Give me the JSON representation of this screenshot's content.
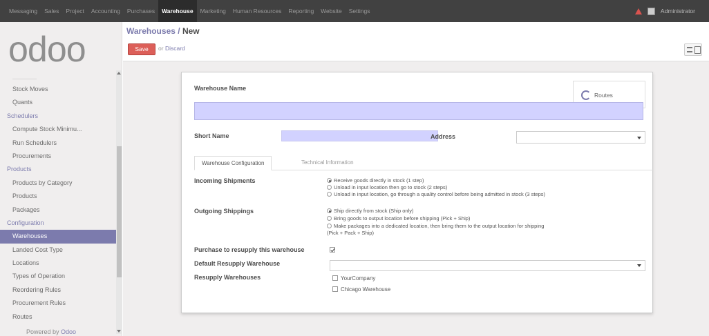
{
  "topbar": {
    "menu": [
      "Messaging",
      "Sales",
      "Project",
      "Accounting",
      "Purchases",
      "Warehouse",
      "Marketing",
      "Human Resources",
      "Reporting",
      "Website",
      "Settings"
    ],
    "active_menu": "Warehouse",
    "user": "Administrator"
  },
  "sidebar": {
    "logo": "odoo",
    "items": [
      {
        "label": "Stock Moves",
        "type": "item"
      },
      {
        "label": "Quants",
        "type": "item"
      },
      {
        "label": "Schedulers",
        "type": "section"
      },
      {
        "label": "Compute Stock Minimu...",
        "type": "item"
      },
      {
        "label": "Run Schedulers",
        "type": "item"
      },
      {
        "label": "Procurements",
        "type": "item"
      },
      {
        "label": "Products",
        "type": "section"
      },
      {
        "label": "Products by Category",
        "type": "item"
      },
      {
        "label": "Products",
        "type": "item"
      },
      {
        "label": "Packages",
        "type": "item"
      },
      {
        "label": "Configuration",
        "type": "section"
      },
      {
        "label": "Warehouses",
        "type": "active"
      },
      {
        "label": "Landed Cost Type",
        "type": "item"
      },
      {
        "label": "Locations",
        "type": "item"
      },
      {
        "label": "Types of Operation",
        "type": "item"
      },
      {
        "label": "Reordering Rules",
        "type": "item"
      },
      {
        "label": "Procurement Rules",
        "type": "item"
      },
      {
        "label": "Routes",
        "type": "item"
      }
    ],
    "powered_prefix": "Powered by",
    "powered_brand": "Odoo"
  },
  "header": {
    "breadcrumb_parent": "Warehouses",
    "breadcrumb_sep": " / ",
    "breadcrumb_current": "New",
    "save_label": "Save",
    "discard_or": "or",
    "discard_label": "Discard"
  },
  "form": {
    "warehouse_name_label": "Warehouse Name",
    "routes_label": "Routes",
    "short_name_label": "Short Name",
    "address_label": "Address",
    "tabs": [
      "Warehouse Configuration",
      "Technical Information"
    ],
    "incoming_label": "Incoming Shipments",
    "incoming_options": [
      "Receive goods directly in stock (1 step)",
      "Unload in input location then go to stock (2 steps)",
      "Unload in input location, go through a quality control before being admitted in stock (3 steps)"
    ],
    "incoming_selected": 0,
    "outgoing_label": "Outgoing Shippings",
    "outgoing_options": [
      "Ship directly from stock (Ship only)",
      "Bring goods to output location before shipping (Pick + Ship)",
      "Make packages into a dedicated location, then bring them to the output location for shipping",
      "(Pick + Pack + Ship)"
    ],
    "outgoing_selected": 0,
    "purchase_resupply_label": "Purchase to resupply this warehouse",
    "purchase_resupply_checked": true,
    "default_resupply_label": "Default Resupply Warehouse",
    "resupply_label": "Resupply Warehouses",
    "resupply_warehouses": [
      "YourCompany",
      "Chicago Warehouse"
    ]
  },
  "colors": {
    "accent": "#7c7bad",
    "save": "#dc5f59",
    "required_field": "#d2d2ff",
    "topbar": "#414141"
  }
}
